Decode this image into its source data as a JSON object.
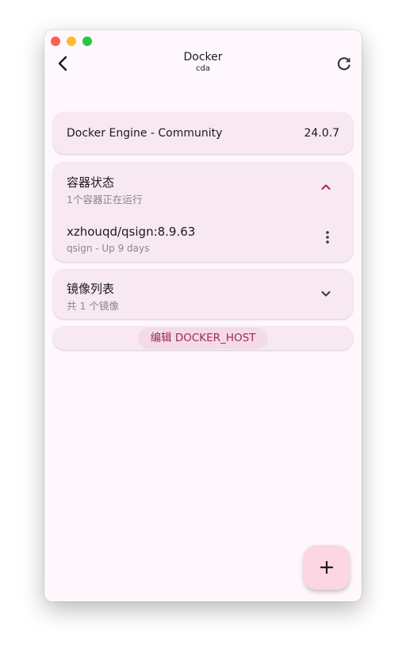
{
  "appbar": {
    "title": "Docker",
    "subtitle": "cda"
  },
  "engine": {
    "name": "Docker Engine - Community",
    "version": "24.0.7"
  },
  "containers": {
    "title": "容器状态",
    "summary": "1个容器正在运行",
    "expanded": true,
    "items": [
      {
        "name": "xzhouqd/qsign:8.9.63",
        "meta": "qsign - Up 9 days"
      }
    ]
  },
  "images": {
    "title": "镜像列表",
    "summary": "共 1 个镜像",
    "expanded": false
  },
  "actions": {
    "edit_host_label": "编辑 DOCKER_HOST"
  },
  "icons": {
    "back": "arrow-back-icon",
    "refresh": "refresh-icon",
    "collapse": "chevron-up-icon",
    "expand": "chevron-down-icon",
    "more": "more-vert-icon",
    "add": "add-icon"
  },
  "colors": {
    "accent": "#a0285f",
    "card": "#f8e8f1",
    "background": "#fef7fb",
    "fab": "#fcd6e2"
  }
}
